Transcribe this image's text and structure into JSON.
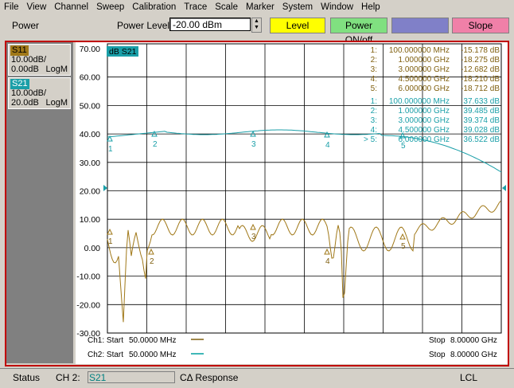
{
  "menu": [
    "File",
    "View",
    "Channel",
    "Sweep",
    "Calibration",
    "Trace",
    "Scale",
    "Marker",
    "System",
    "Window",
    "Help"
  ],
  "toolbar": {
    "section_label": "Power",
    "power_level_label": "Power Level",
    "power_level_value": "-20.00 dBm",
    "buttons": [
      {
        "label": "Level",
        "color": "#ffff00"
      },
      {
        "label": "Power ON/off",
        "color": "#80e080"
      },
      {
        "label": "",
        "color": "#8080c8"
      },
      {
        "label": "Slope",
        "color": "#f080a8"
      }
    ]
  },
  "traces": [
    {
      "name": "S11",
      "scale": "10.00dB/",
      "ref": "0.00dB",
      "format": "LogM",
      "color": "#a07818"
    },
    {
      "name": "S21",
      "scale": "10.00dB/",
      "ref": "20.0dB",
      "format": "LogM",
      "color": "#00a0a0"
    }
  ],
  "plot": {
    "active_label": "dB S21",
    "y_ticks": [
      "70.00",
      "60.00",
      "50.00",
      "40.00",
      "30.00",
      "20.00",
      "10.00",
      "0.00",
      "-10.00",
      "-20.00",
      "-30.00"
    ]
  },
  "markers": {
    "ch1": [
      {
        "id": "1:",
        "freq": "100.000000 MHz",
        "value": "-15.178 dB"
      },
      {
        "id": "2:",
        "freq": "1.000000 GHz",
        "value": "-18.275 dB"
      },
      {
        "id": "3:",
        "freq": "3.000000 GHz",
        "value": "-12.682 dB"
      },
      {
        "id": "4:",
        "freq": "4.500000 GHz",
        "value": "-18.210 dB"
      },
      {
        "id": "5:",
        "freq": "6.000000 GHz",
        "value": "-18.712 dB"
      }
    ],
    "ch2": [
      {
        "id": "1:",
        "freq": "100.000000 MHz",
        "value": "37.633 dB"
      },
      {
        "id": "2:",
        "freq": "1.000000 GHz",
        "value": "39.485 dB"
      },
      {
        "id": "3:",
        "freq": "3.000000 GHz",
        "value": "39.374 dB"
      },
      {
        "id": "4:",
        "freq": "4.500000 GHz",
        "value": "39.028 dB"
      },
      {
        "id": "> 5:",
        "freq": "6.000000 GHz",
        "value": "36.522 dB"
      }
    ]
  },
  "channels": [
    {
      "label": "Ch1: Start",
      "start": "50.0000 MHz",
      "stop_label": "Stop",
      "stop": "8.00000 GHz",
      "color": "#806010"
    },
    {
      "label": "Ch2: Start",
      "start": "50.0000 MHz",
      "stop_label": "Stop",
      "stop": "8.00000 GHz",
      "color": "#00a0a0"
    }
  ],
  "status": {
    "label": "Status",
    "channel": "CH 2:",
    "param": "S21",
    "mode": "CΔ Response",
    "lcl": "LCL"
  },
  "colors": {
    "s11": "#a07818",
    "s21": "#1a9fa8",
    "frame": "#c00000"
  }
}
